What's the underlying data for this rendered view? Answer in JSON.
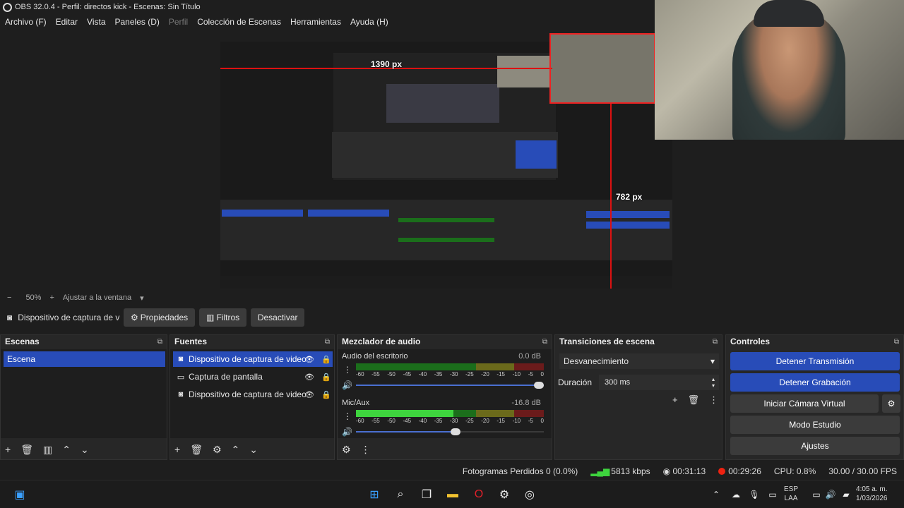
{
  "window": {
    "title": "OBS 32.0.4 - Perfil: directos kick - Escenas: Sin Título"
  },
  "menu": [
    {
      "label": "Archivo (F)",
      "enabled": true
    },
    {
      "label": "Editar",
      "enabled": true
    },
    {
      "label": "Vista",
      "enabled": true
    },
    {
      "label": "Paneles (D)",
      "enabled": true
    },
    {
      "label": "Perfil",
      "enabled": false
    },
    {
      "label": "Colección de Escenas",
      "enabled": true
    },
    {
      "label": "Herramientas",
      "enabled": true
    },
    {
      "label": "Ayuda (H)",
      "enabled": true
    }
  ],
  "preview": {
    "measure_top": "1390 px",
    "measure_right": "782 px"
  },
  "preview_toolbar": {
    "minus": "−",
    "zoom": "50%",
    "plus": "+",
    "fit": "Ajustar a la ventana"
  },
  "source_toolbar": {
    "source_name": "Dispositivo de captura de v",
    "properties": "Propiedades",
    "filters": "Filtros",
    "deactivate": "Desactivar"
  },
  "scenes": {
    "title": "Escenas",
    "items": [
      "Escena"
    ]
  },
  "sources": {
    "title": "Fuentes",
    "items": [
      {
        "label": "Dispositivo de captura de video",
        "icon": "camera-icon"
      },
      {
        "label": "Captura de pantalla",
        "icon": "monitor-icon"
      },
      {
        "label": "Dispositivo de captura de video",
        "icon": "camera-icon"
      }
    ]
  },
  "mixer": {
    "title": "Mezclador de audio",
    "ticks": [
      "-60",
      "-55",
      "-50",
      "-45",
      "-40",
      "-35",
      "-30",
      "-25",
      "-20",
      "-15",
      "-10",
      "-5",
      "0"
    ],
    "channels": [
      {
        "name": "Audio del escritorio",
        "db": "0.0 dB",
        "level": 0,
        "volume": 1.0
      },
      {
        "name": "Mic/Aux",
        "db": "-16.8 dB",
        "level": 0.52,
        "volume": 0.53
      }
    ]
  },
  "transitions": {
    "title": "Transiciones de escena",
    "selected": "Desvanecimiento",
    "duration_label": "Duración",
    "duration_value": "300 ms"
  },
  "controls": {
    "title": "Controles",
    "buttons": [
      {
        "label": "Detener Transmisión",
        "active": true
      },
      {
        "label": "Detener Grabación",
        "active": true
      },
      {
        "label": "Iniciar Cámara Virtual",
        "active": false
      },
      {
        "label": "Modo Estudio",
        "active": false
      },
      {
        "label": "Ajustes",
        "active": false
      }
    ]
  },
  "status": {
    "dropped": "Fotogramas Perdidos 0 (0.0%)",
    "bitrate": "5813 kbps",
    "stream_time": "00:31:13",
    "rec_time": "00:29:26",
    "cpu": "CPU: 0.8%",
    "fps": "30.00 / 30.00 FPS"
  },
  "taskbar": {
    "lang": "ESP",
    "layout": "LAA",
    "time": "4:05 a. m.",
    "date": "1/03/2026"
  }
}
